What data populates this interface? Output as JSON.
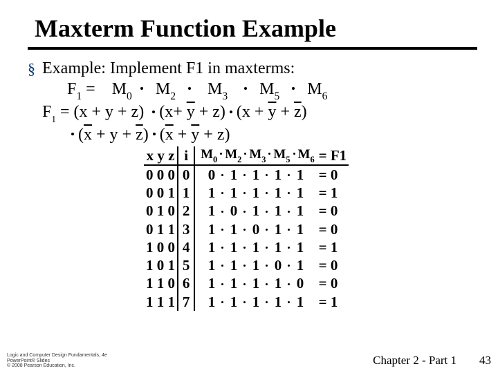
{
  "title": "Maxterm Function Example",
  "bullet_intro": "Example:  Implement  F1 in maxterms:",
  "line_f1_eq": "F",
  "eq_text": " =",
  "maxterms": [
    "M",
    "M",
    "M",
    "M",
    "M"
  ],
  "maxterm_subs": [
    "0",
    "2",
    "3",
    "5",
    "6"
  ],
  "expansion_l1a": "F",
  "expansion_l1b": " = (x + y + z)",
  "expansion_l1c": "(x+ ",
  "expansion_l1d": " + z)",
  "expansion_l1e": "(x + ",
  "expansion_l1f": " + ",
  "expansion_l1g": ")",
  "expansion_l2a": "(",
  "expansion_l2b": " + y + ",
  "expansion_l2c": ")",
  "expansion_l2d": "(",
  "expansion_l2e": " + ",
  "expansion_l2f": " + z)",
  "ybar": "y",
  "zbar": "z",
  "xbar": "x",
  "table": {
    "hdr_xyz": "x y z",
    "hdr_i": "i",
    "hdr_eq": "= F1",
    "rows": [
      {
        "xyz": "0 0 0",
        "i": "0",
        "v": [
          "0",
          "1",
          "1",
          "1",
          "1"
        ],
        "r": "=  0"
      },
      {
        "xyz": "0 0 1",
        "i": "1",
        "v": [
          "1",
          "1",
          "1",
          "1",
          "1"
        ],
        "r": "=  1"
      },
      {
        "xyz": "0 1 0",
        "i": "2",
        "v": [
          "1",
          "0",
          "1",
          "1",
          "1"
        ],
        "r": "=  0"
      },
      {
        "xyz": "0 1 1",
        "i": "3",
        "v": [
          "1",
          "1",
          "0",
          "1",
          "1"
        ],
        "r": "=  0"
      },
      {
        "xyz": "1 0 0",
        "i": "4",
        "v": [
          "1",
          "1",
          "1",
          "1",
          "1"
        ],
        "r": "=  1"
      },
      {
        "xyz": "1 0 1",
        "i": "5",
        "v": [
          "1",
          "1",
          "1",
          "0",
          "1"
        ],
        "r": "=  0"
      },
      {
        "xyz": "1 1 0",
        "i": "6",
        "v": [
          "1",
          "1",
          "1",
          "1",
          "0"
        ],
        "r": "=  0"
      },
      {
        "xyz": "1 1 1",
        "i": "7",
        "v": [
          "1",
          "1",
          "1",
          "1",
          "1"
        ],
        "r": "=  1"
      }
    ]
  },
  "footer_left_l1": "Logic and Computer Design Fundamentals, 4e",
  "footer_left_l2": "PowerPoint® Slides",
  "footer_left_l3": "© 2008 Pearson Education, Inc.",
  "footer_right": "Chapter 2 - Part 1",
  "page_num": "43",
  "chart_data": {
    "type": "table",
    "title": "Maxterm truth table for F1",
    "columns": [
      "x",
      "y",
      "z",
      "i",
      "M0",
      "M2",
      "M3",
      "M5",
      "M6",
      "F1"
    ],
    "rows": [
      [
        0,
        0,
        0,
        0,
        0,
        1,
        1,
        1,
        1,
        0
      ],
      [
        0,
        0,
        1,
        1,
        1,
        1,
        1,
        1,
        1,
        1
      ],
      [
        0,
        1,
        0,
        2,
        1,
        0,
        1,
        1,
        1,
        0
      ],
      [
        0,
        1,
        1,
        3,
        1,
        1,
        0,
        1,
        1,
        0
      ],
      [
        1,
        0,
        0,
        4,
        1,
        1,
        1,
        1,
        1,
        1
      ],
      [
        1,
        0,
        1,
        5,
        1,
        1,
        1,
        0,
        1,
        0
      ],
      [
        1,
        1,
        0,
        6,
        1,
        1,
        1,
        1,
        0,
        0
      ],
      [
        1,
        1,
        1,
        7,
        1,
        1,
        1,
        1,
        1,
        1
      ]
    ]
  }
}
